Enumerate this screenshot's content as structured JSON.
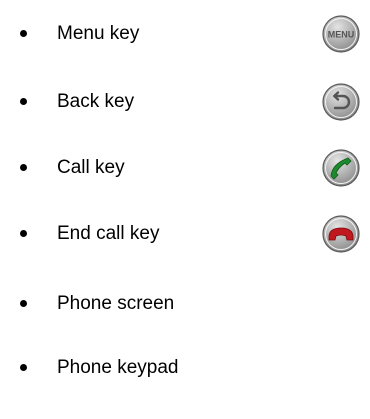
{
  "items": [
    {
      "label": "Menu key",
      "icon": "menu-key-icon",
      "icon_text": "MENU"
    },
    {
      "label": "Back key",
      "icon": "back-key-icon"
    },
    {
      "label": "Call key",
      "icon": "call-key-icon",
      "icon_color": "#1e8a2e"
    },
    {
      "label": "End call key",
      "icon": "end-call-key-icon",
      "icon_color": "#c0181e"
    },
    {
      "label": "Phone screen"
    },
    {
      "label": "Phone keypad"
    }
  ]
}
